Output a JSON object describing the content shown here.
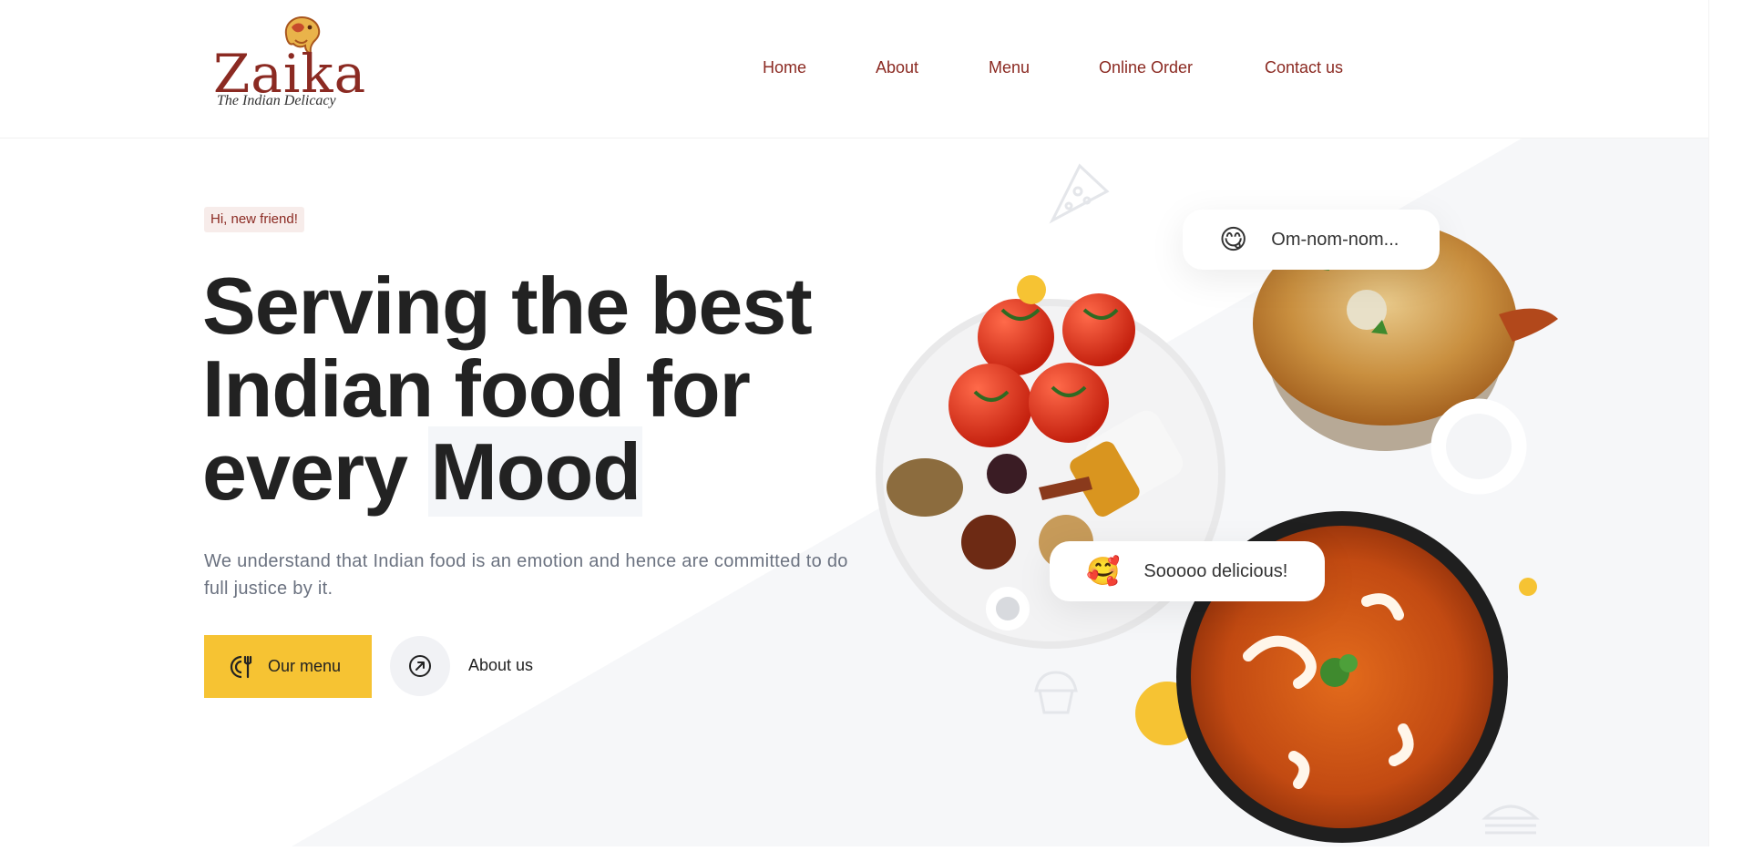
{
  "brand": {
    "name": "Zaika",
    "tagline": "The Indian Delicacy"
  },
  "nav": {
    "items": [
      "Home",
      "About",
      "Menu",
      "Online Order",
      "Contact us"
    ]
  },
  "hero": {
    "greeting": "Hi, new friend!",
    "headline_line1": "Serving the best",
    "headline_line2": "Indian food for",
    "headline_line3_prefix": "every ",
    "headline_highlight": "Mood",
    "description": "We understand that Indian food is an emotion and hence are committed to do full justice by it.",
    "primary_button": "Our menu",
    "secondary_button": "About us"
  },
  "bubbles": {
    "top": {
      "emoji": "😋",
      "text": "Om-nom-nom..."
    },
    "bottom": {
      "emoji": "🥰",
      "text": "Sooooo delicious!"
    }
  },
  "colors": {
    "brand_red": "#8b2a22",
    "accent_yellow": "#f6c333",
    "text_dark": "#222222",
    "text_muted": "#6b7280",
    "bg_soft": "#f6f7f9"
  },
  "icons": {
    "menu_button": "fork-plate-icon",
    "about_button": "compass-arrow-icon",
    "decor": [
      "pizza-slice-icon",
      "cupcake-icon",
      "burger-icon"
    ]
  }
}
